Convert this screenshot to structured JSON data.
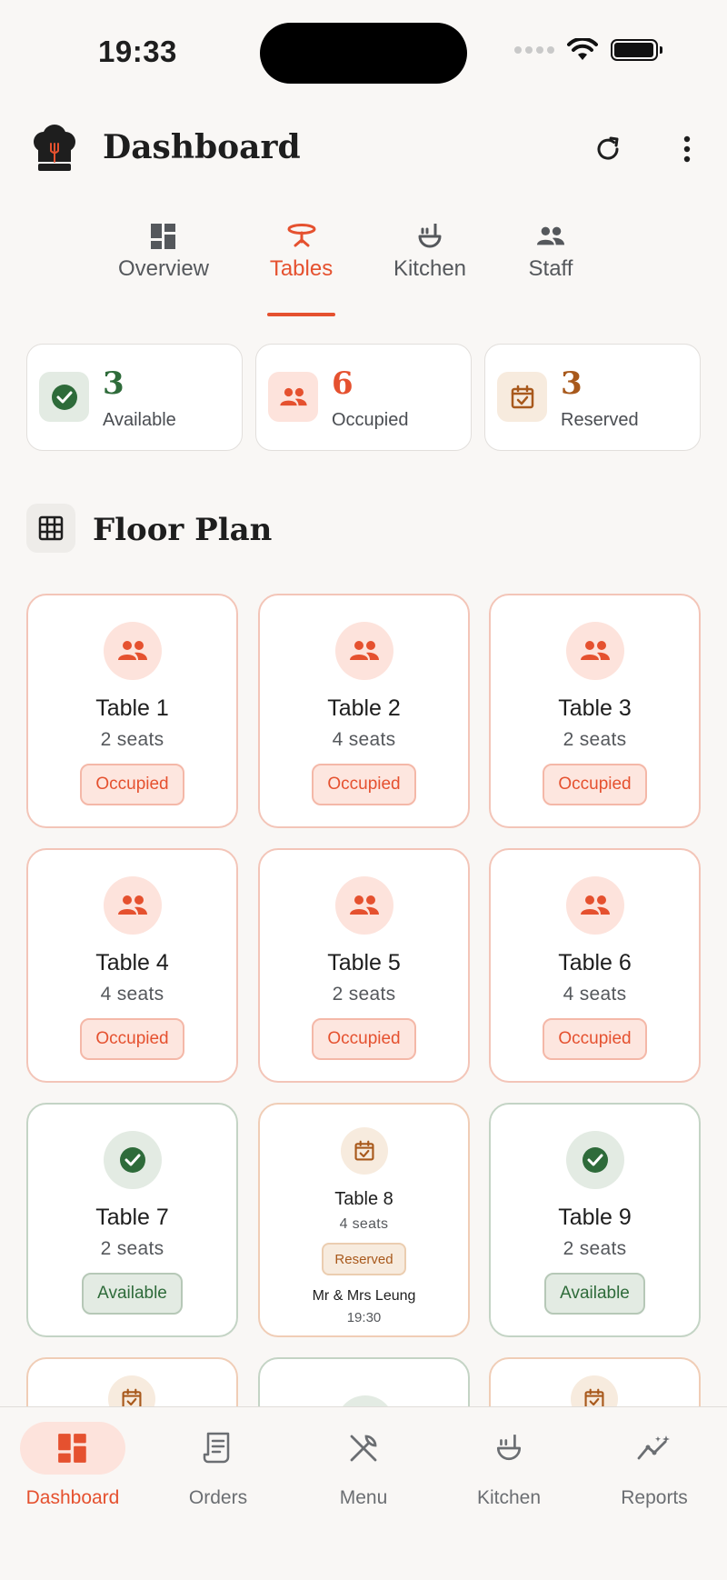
{
  "status_bar": {
    "time": "19:33"
  },
  "header": {
    "title": "Dashboard",
    "logo_icon": "chef-hat-icon",
    "refresh_icon": "refresh-icon",
    "more_icon": "more-vertical-icon"
  },
  "tabs": [
    {
      "label": "Overview",
      "icon": "dashboard-grid-icon",
      "active": false
    },
    {
      "label": "Tables",
      "icon": "table-icon",
      "active": true
    },
    {
      "label": "Kitchen",
      "icon": "ladle-icon",
      "active": false
    },
    {
      "label": "Staff",
      "icon": "people-icon",
      "active": false
    }
  ],
  "summary": [
    {
      "count": "3",
      "label": "Available",
      "color": "#2e6b3a"
    },
    {
      "count": "6",
      "label": "Occupied",
      "color": "#e5512f"
    },
    {
      "count": "3",
      "label": "Reserved",
      "color": "#a8591c"
    }
  ],
  "floor_plan": {
    "title": "Floor Plan",
    "tables": [
      {
        "name": "Table 1",
        "seats": "2 seats",
        "status": "Occupied"
      },
      {
        "name": "Table 2",
        "seats": "4 seats",
        "status": "Occupied"
      },
      {
        "name": "Table 3",
        "seats": "2 seats",
        "status": "Occupied"
      },
      {
        "name": "Table 4",
        "seats": "4 seats",
        "status": "Occupied"
      },
      {
        "name": "Table 5",
        "seats": "2 seats",
        "status": "Occupied"
      },
      {
        "name": "Table 6",
        "seats": "4 seats",
        "status": "Occupied"
      },
      {
        "name": "Table 7",
        "seats": "2 seats",
        "status": "Available"
      },
      {
        "name": "Table 8",
        "seats": "4 seats",
        "status": "Reserved",
        "guest": "Mr & Mrs Leung",
        "time": "19:30"
      },
      {
        "name": "Table 9",
        "seats": "2 seats",
        "status": "Available"
      }
    ]
  },
  "bottom_nav": [
    {
      "label": "Dashboard",
      "icon": "dashboard-icon",
      "active": true
    },
    {
      "label": "Orders",
      "icon": "receipt-icon",
      "active": false
    },
    {
      "label": "Menu",
      "icon": "utensils-icon",
      "active": false
    },
    {
      "label": "Kitchen",
      "icon": "ladle-icon",
      "active": false
    },
    {
      "label": "Reports",
      "icon": "chart-sparkle-icon",
      "active": false
    }
  ],
  "colors": {
    "accent": "#e5512f",
    "available": "#2e6b3a",
    "reserved": "#a8591c",
    "background": "#f9f7f5"
  }
}
